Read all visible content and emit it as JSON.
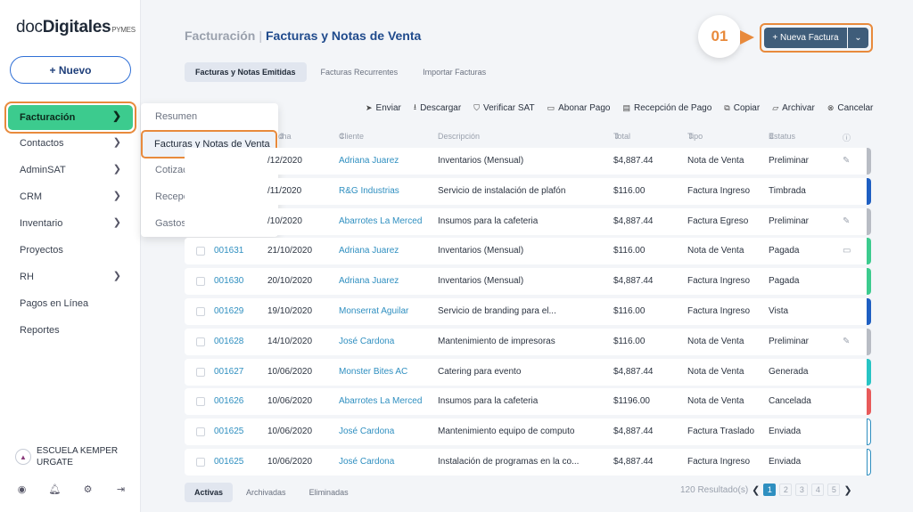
{
  "app": {
    "logo_light": "doc",
    "logo_bold": "Digitales",
    "logo_suffix": "PYMES"
  },
  "sidebar": {
    "new_label": "+ Nuevo",
    "active_item": "Facturación",
    "items": [
      {
        "label": "Contactos",
        "chevron": true
      },
      {
        "label": "AdminSAT",
        "chevron": true
      },
      {
        "label": "CRM",
        "chevron": true
      },
      {
        "label": "Inventario",
        "chevron": true
      },
      {
        "label": "Proyectos",
        "chevron": false
      },
      {
        "label": "RH",
        "chevron": true
      },
      {
        "label": "Pagos en Línea",
        "chevron": false
      },
      {
        "label": "Reportes",
        "chevron": false
      }
    ],
    "org_line1": "ESCUELA KEMPER",
    "org_line2": "URGATE"
  },
  "submenu": {
    "items": [
      "Resumen",
      "Facturas y Notas de Venta",
      "Cotizaciones",
      "Recepción de Pagos",
      "Gastos"
    ],
    "highlighted": "Facturas y Notas de Venta"
  },
  "header": {
    "section": "Facturación",
    "separator": "|",
    "page_title": "Facturas y Notas de Venta",
    "step_label": "01",
    "new_invoice_label": "+ Nueva Factura"
  },
  "tabs": [
    "Facturas y Notas Emitidas",
    "Facturas Recurrentes",
    "Importar Facturas"
  ],
  "toolbar": [
    "Enviar",
    "Descargar",
    "Verificar SAT",
    "Abonar Pago",
    "Recepción de Pago",
    "Copiar",
    "Archivar",
    "Cancelar"
  ],
  "table": {
    "headers": {
      "fecha": "cha",
      "cliente": "Cliente",
      "descripcion": "Descripción",
      "total": "Total",
      "tipo": "Tipo",
      "estatus": "Estatus"
    },
    "rows": [
      {
        "folio": "",
        "fecha": "/12/2020",
        "cliente": "Adriana Juarez",
        "desc": "Inventarios (Mensual)",
        "total": "$4,887.44",
        "tipo": "Nota de Venta",
        "estatus": "Preliminar",
        "act": "✎",
        "color": "#b8bcc4"
      },
      {
        "folio": "",
        "fecha": "/11/2020",
        "cliente": "R&G Industrias",
        "desc": "Servicio de instalación de plafón",
        "total": "$116.00",
        "tipo": "Factura Ingreso",
        "estatus": "Timbrada",
        "act": "",
        "color": "#1f5fc2"
      },
      {
        "folio": "",
        "fecha": "/10/2020",
        "cliente": "Abarrotes La Merced",
        "desc": "Insumos para la cafeteria",
        "total": "$4,887.44",
        "tipo": "Factura Egreso",
        "estatus": "Preliminar",
        "act": "✎",
        "color": "#b8bcc4"
      },
      {
        "folio": "001631",
        "fecha": "21/10/2020",
        "cliente": "Adriana Juarez",
        "desc": "Inventarios (Mensual)",
        "total": "$116.00",
        "tipo": "Nota de Venta",
        "estatus": "Pagada",
        "act": "▭",
        "color": "#3ccb8e"
      },
      {
        "folio": "001630",
        "fecha": "20/10/2020",
        "cliente": "Adriana Juarez",
        "desc": "Inventarios (Mensual)",
        "total": "$4,887.44",
        "tipo": "Factura Ingreso",
        "estatus": "Pagada",
        "act": "",
        "color": "#3ccb8e"
      },
      {
        "folio": "001629",
        "fecha": "19/10/2020",
        "cliente": "Monserrat Aguilar",
        "desc": "Servicio de branding para el...",
        "total": "$116.00",
        "tipo": "Factura Ingreso",
        "estatus": "Vista",
        "act": "",
        "color": "#1f5fc2"
      },
      {
        "folio": "001628",
        "fecha": "14/10/2020",
        "cliente": "José Cardona",
        "desc": "Mantenimiento de impresoras",
        "total": "$116.00",
        "tipo": "Nota de Venta",
        "estatus": "Preliminar",
        "act": "✎",
        "color": "#b8bcc4"
      },
      {
        "folio": "001627",
        "fecha": "10/06/2020",
        "cliente": "Monster Bites AC",
        "desc": "Catering para evento",
        "total": "$4,887.44",
        "tipo": "Nota de Venta",
        "estatus": "Generada",
        "act": "",
        "color": "#27c4c4"
      },
      {
        "folio": "001626",
        "fecha": "10/06/2020",
        "cliente": "Abarrotes La Merced",
        "desc": "Insumos para la cafeteria",
        "total": "$1196.00",
        "tipo": "Nota de Venta",
        "estatus": "Cancelada",
        "act": "",
        "color": "#e85a5a"
      },
      {
        "folio": "001625",
        "fecha": "10/06/2020",
        "cliente": "José Cardona",
        "desc": "Mantenimiento equipo de computo",
        "total": "$4,887.44",
        "tipo": "Factura Traslado",
        "estatus": "Enviada",
        "act": "",
        "color": "outline"
      },
      {
        "folio": "001625",
        "fecha": "10/06/2020",
        "cliente": "José Cardona",
        "desc": "Instalación de programas en la co...",
        "total": "$4,887.44",
        "tipo": "Factura Ingreso",
        "estatus": "Enviada",
        "act": "",
        "color": "outline"
      }
    ]
  },
  "footer": {
    "tabs": [
      "Activas",
      "Archivadas",
      "Eliminadas"
    ],
    "results": "120 Resultado(s)",
    "pages": [
      "1",
      "2",
      "3",
      "4",
      "5"
    ],
    "current_page": "1"
  }
}
